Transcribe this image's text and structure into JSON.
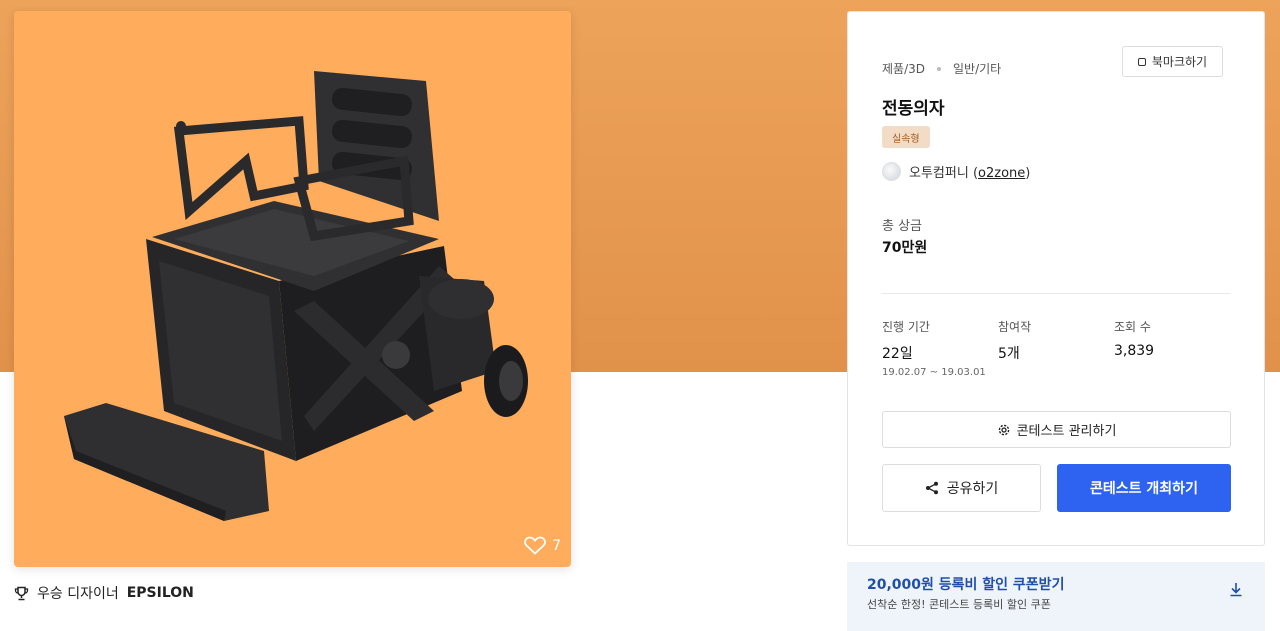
{
  "contest": {
    "category": "제품/3D",
    "subcategory": "일반/기타",
    "title": "전동의자",
    "type_badge": "실속형",
    "host_name": "오투컴퍼니",
    "host_id": "o2zone",
    "host_id_open": "(",
    "host_id_close": ")"
  },
  "bookmark_label": "북마크하기",
  "prize": {
    "label": "총 상금",
    "value": "70만원"
  },
  "stats": {
    "period_label": "진행 기간",
    "period_value": "22일",
    "period_range": "19.02.07 ~ 19.03.01",
    "entries_label": "참여작",
    "entries_value": "5개",
    "views_label": "조회 수",
    "views_value": "3,839"
  },
  "buttons": {
    "manage": "콘테스트 관리하기",
    "share": "공유하기",
    "host": "콘테스트 개최하기"
  },
  "coupon": {
    "title": "20,000원 등록비 할인 쿠폰받기",
    "subtitle": "선착순 한정! 콘테스트 등록비 할인 쿠폰"
  },
  "likes": "7",
  "winner": {
    "prefix": "우승 디자이너",
    "name": "EPSILON"
  },
  "icons": {
    "trophy": "trophy-icon",
    "heart": "heart-icon",
    "gear": "gear-icon",
    "share": "share-icon",
    "download": "download-icon",
    "bookmark": "bookmark-icon"
  },
  "colors": {
    "hero_bg": "#eda35a",
    "image_bg": "#ffad5c",
    "primary": "#2e63f2",
    "coupon_bg": "#eff4fb",
    "coupon_text": "#1f4fa8",
    "badge_bg": "#f3dcc6",
    "badge_text": "#a25b1f"
  }
}
